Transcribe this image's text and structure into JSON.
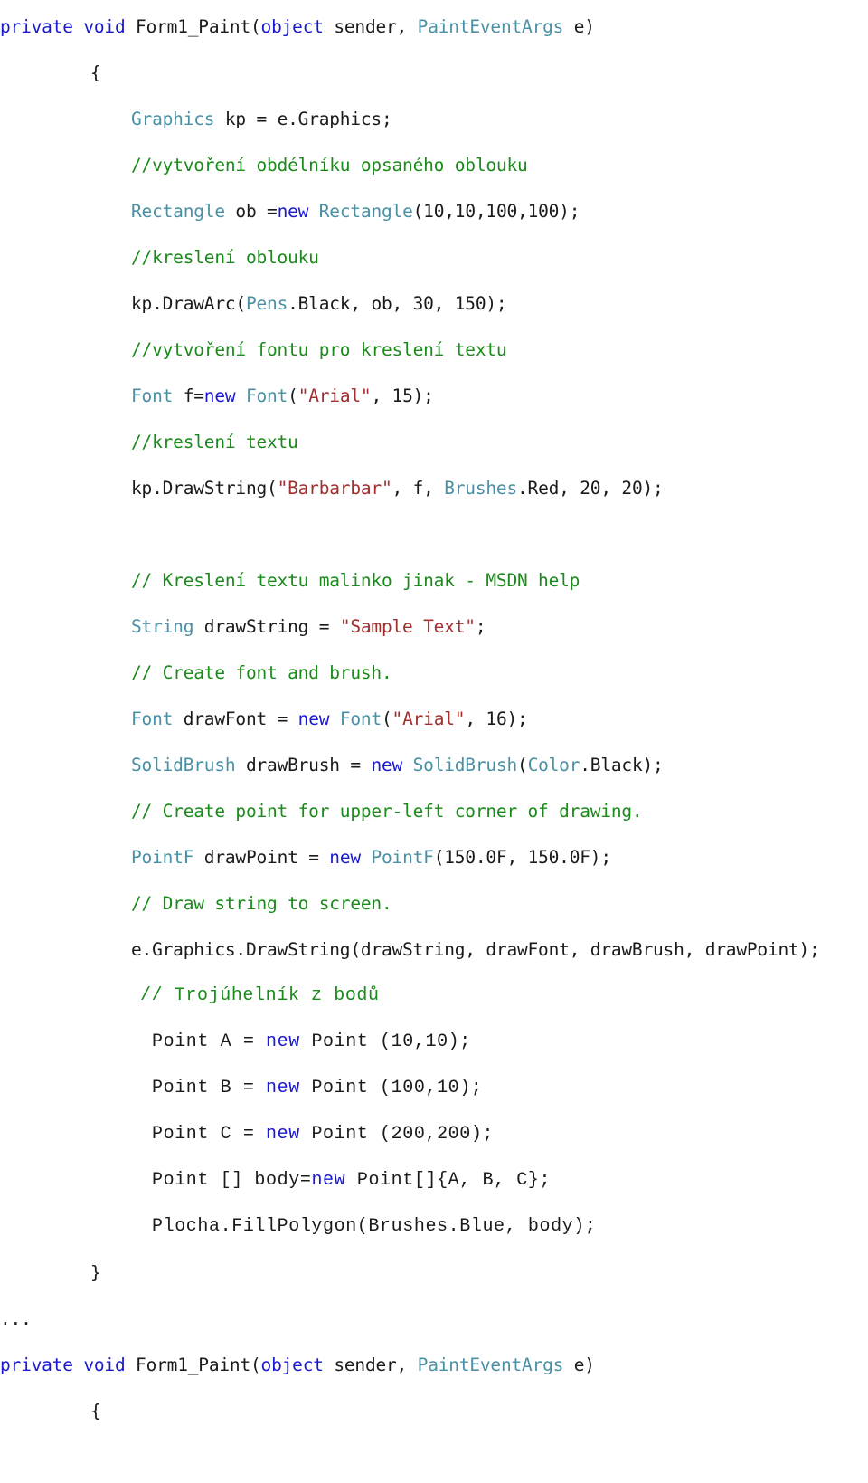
{
  "document": {
    "kind": "code-listing",
    "language": "C#",
    "background_color": "#ffffff"
  },
  "colors": {
    "keyword": "#1a1ad0",
    "type": "#4a90a4",
    "comment": "#1a8a1a",
    "string": "#a03030",
    "plain": "#1a1a1a",
    "background": "#ffffff"
  },
  "code": {
    "lines": [
      {
        "id": "line-1",
        "indent": "ind-0",
        "font": "sans",
        "tokens": [
          {
            "t": "private",
            "c": "kw"
          },
          {
            "t": " ",
            "c": "plain"
          },
          {
            "t": "void",
            "c": "kw"
          },
          {
            "t": " Form1_Paint(",
            "c": "plain"
          },
          {
            "t": "object",
            "c": "kw"
          },
          {
            "t": " sender, ",
            "c": "plain"
          },
          {
            "t": "PaintEventArgs",
            "c": "type"
          },
          {
            "t": " e)",
            "c": "plain"
          }
        ]
      },
      {
        "id": "line-2",
        "indent": "ind-1",
        "font": "sans",
        "tokens": [
          {
            "t": "{",
            "c": "plain"
          }
        ]
      },
      {
        "id": "line-3",
        "indent": "ind-2",
        "font": "sans",
        "tokens": [
          {
            "t": "Graphics",
            "c": "type"
          },
          {
            "t": " kp = e.Graphics;",
            "c": "plain"
          }
        ]
      },
      {
        "id": "line-4",
        "indent": "ind-2",
        "font": "sans",
        "tokens": [
          {
            "t": "//vytvoření obdélníku opsaného oblouku",
            "c": "comment"
          }
        ]
      },
      {
        "id": "line-5",
        "indent": "ind-2",
        "font": "sans",
        "tokens": [
          {
            "t": "Rectangle",
            "c": "type"
          },
          {
            "t": " ob =",
            "c": "plain"
          },
          {
            "t": "new",
            "c": "kw"
          },
          {
            "t": " ",
            "c": "plain"
          },
          {
            "t": "Rectangle",
            "c": "type"
          },
          {
            "t": "(10,10,100,100);",
            "c": "plain"
          }
        ]
      },
      {
        "id": "line-6",
        "indent": "ind-2",
        "font": "sans",
        "tokens": [
          {
            "t": "//kreslení oblouku",
            "c": "comment"
          }
        ]
      },
      {
        "id": "line-7",
        "indent": "ind-2",
        "font": "sans",
        "tokens": [
          {
            "t": "kp.DrawArc(",
            "c": "plain"
          },
          {
            "t": "Pens",
            "c": "type"
          },
          {
            "t": ".Black, ob, 30, 150);",
            "c": "plain"
          }
        ]
      },
      {
        "id": "line-8",
        "indent": "ind-2",
        "font": "sans",
        "tokens": [
          {
            "t": "//vytvoření fontu pro kreslení textu",
            "c": "comment"
          }
        ]
      },
      {
        "id": "line-9",
        "indent": "ind-2",
        "font": "sans",
        "tokens": [
          {
            "t": "Font",
            "c": "type"
          },
          {
            "t": " f=",
            "c": "plain"
          },
          {
            "t": "new",
            "c": "kw"
          },
          {
            "t": " ",
            "c": "plain"
          },
          {
            "t": "Font",
            "c": "type"
          },
          {
            "t": "(",
            "c": "plain"
          },
          {
            "t": "\"Arial\"",
            "c": "str"
          },
          {
            "t": ", 15);",
            "c": "plain"
          }
        ]
      },
      {
        "id": "line-10",
        "indent": "ind-2",
        "font": "sans",
        "tokens": [
          {
            "t": "//kreslení textu",
            "c": "comment"
          }
        ]
      },
      {
        "id": "line-11",
        "indent": "ind-2",
        "font": "sans",
        "tokens": [
          {
            "t": "kp.DrawString(",
            "c": "plain"
          },
          {
            "t": "\"Barbarbar\"",
            "c": "str"
          },
          {
            "t": ", f, ",
            "c": "plain"
          },
          {
            "t": "Brushes",
            "c": "type"
          },
          {
            "t": ".Red, 20, 20);",
            "c": "plain"
          }
        ]
      },
      {
        "id": "line-12",
        "indent": "ind-2",
        "font": "sans",
        "blank": true,
        "tokens": []
      },
      {
        "id": "line-13",
        "indent": "ind-2",
        "font": "sans",
        "tokens": [
          {
            "t": "// Kreslení textu malinko jinak - MSDN help",
            "c": "comment"
          }
        ]
      },
      {
        "id": "line-14",
        "indent": "ind-2",
        "font": "sans",
        "tokens": [
          {
            "t": "String",
            "c": "type"
          },
          {
            "t": " drawString = ",
            "c": "plain"
          },
          {
            "t": "\"Sample Text\"",
            "c": "str"
          },
          {
            "t": ";",
            "c": "plain"
          }
        ]
      },
      {
        "id": "line-15",
        "indent": "ind-2",
        "font": "sans",
        "tokens": [
          {
            "t": "// Create font and brush.",
            "c": "comment"
          }
        ]
      },
      {
        "id": "line-16",
        "indent": "ind-2",
        "font": "sans",
        "tokens": [
          {
            "t": "Font",
            "c": "type"
          },
          {
            "t": " drawFont = ",
            "c": "plain"
          },
          {
            "t": "new",
            "c": "kw"
          },
          {
            "t": " ",
            "c": "plain"
          },
          {
            "t": "Font",
            "c": "type"
          },
          {
            "t": "(",
            "c": "plain"
          },
          {
            "t": "\"Arial\"",
            "c": "str"
          },
          {
            "t": ", 16);",
            "c": "plain"
          }
        ]
      },
      {
        "id": "line-17",
        "indent": "ind-2",
        "font": "sans",
        "tokens": [
          {
            "t": "SolidBrush",
            "c": "type"
          },
          {
            "t": " drawBrush = ",
            "c": "plain"
          },
          {
            "t": "new",
            "c": "kw"
          },
          {
            "t": " ",
            "c": "plain"
          },
          {
            "t": "SolidBrush",
            "c": "type"
          },
          {
            "t": "(",
            "c": "plain"
          },
          {
            "t": "Color",
            "c": "type"
          },
          {
            "t": ".Black);",
            "c": "plain"
          }
        ]
      },
      {
        "id": "line-18",
        "indent": "ind-2",
        "font": "sans",
        "tokens": [
          {
            "t": "// Create point for upper-left corner of drawing.",
            "c": "comment"
          }
        ]
      },
      {
        "id": "line-19",
        "indent": "ind-2",
        "font": "sans",
        "tokens": [
          {
            "t": "PointF",
            "c": "type"
          },
          {
            "t": " drawPoint = ",
            "c": "plain"
          },
          {
            "t": "new",
            "c": "kw"
          },
          {
            "t": " ",
            "c": "plain"
          },
          {
            "t": "PointF",
            "c": "type"
          },
          {
            "t": "(150.0F, 150.0F);",
            "c": "plain"
          }
        ]
      },
      {
        "id": "line-20",
        "indent": "ind-2",
        "font": "sans",
        "tokens": [
          {
            "t": "// Draw string to screen.",
            "c": "comment"
          }
        ]
      },
      {
        "id": "line-21",
        "indent": "ind-2",
        "font": "sans",
        "tokens": [
          {
            "t": "e.Graphics.DrawString(drawString, drawFont, drawBrush, drawPoint);",
            "c": "plain"
          }
        ]
      },
      {
        "id": "line-22",
        "indent": "ind-2b",
        "font": "courier",
        "tokens": [
          {
            "t": "// Trojúhelník z bodů",
            "c": "comment"
          }
        ]
      },
      {
        "id": "line-23",
        "indent": "ind-2c",
        "font": "courier",
        "tokens": [
          {
            "t": "Point A = ",
            "c": "plain"
          },
          {
            "t": "new",
            "c": "kw"
          },
          {
            "t": " Point (10,10);",
            "c": "plain"
          }
        ]
      },
      {
        "id": "line-24",
        "indent": "ind-2c",
        "font": "courier",
        "tokens": [
          {
            "t": "Point B = ",
            "c": "plain"
          },
          {
            "t": "new",
            "c": "kw"
          },
          {
            "t": " Point (100,10);",
            "c": "plain"
          }
        ]
      },
      {
        "id": "line-25",
        "indent": "ind-2c",
        "font": "courier",
        "tokens": [
          {
            "t": "Point C = ",
            "c": "plain"
          },
          {
            "t": "new",
            "c": "kw"
          },
          {
            "t": " Point (200,200);",
            "c": "plain"
          }
        ]
      },
      {
        "id": "line-26",
        "indent": "ind-2c",
        "font": "courier",
        "tokens": [
          {
            "t": "Point [] body=",
            "c": "plain"
          },
          {
            "t": "new",
            "c": "kw"
          },
          {
            "t": " Point[]{A, B, C};",
            "c": "plain"
          }
        ]
      },
      {
        "id": "line-27",
        "indent": "ind-2c",
        "font": "courier",
        "tokens": [
          {
            "t": "Plocha.FillPolygon(Brushes.Blue, body);",
            "c": "plain"
          }
        ]
      },
      {
        "id": "line-28",
        "indent": "ind-1",
        "font": "sans",
        "tokens": [
          {
            "t": "}",
            "c": "plain"
          }
        ]
      },
      {
        "id": "line-29",
        "indent": "ind-0",
        "font": "sans",
        "tokens": [
          {
            "t": "...",
            "c": "plain"
          }
        ]
      },
      {
        "id": "line-30",
        "indent": "ind-0",
        "font": "sans",
        "tokens": [
          {
            "t": "private",
            "c": "kw"
          },
          {
            "t": " ",
            "c": "plain"
          },
          {
            "t": "void",
            "c": "kw"
          },
          {
            "t": " Form1_Paint(",
            "c": "plain"
          },
          {
            "t": "object",
            "c": "kw"
          },
          {
            "t": " sender, ",
            "c": "plain"
          },
          {
            "t": "PaintEventArgs",
            "c": "type"
          },
          {
            "t": " e)",
            "c": "plain"
          }
        ]
      },
      {
        "id": "line-31",
        "indent": "ind-1",
        "font": "sans",
        "tokens": [
          {
            "t": "{",
            "c": "plain"
          }
        ]
      }
    ]
  }
}
